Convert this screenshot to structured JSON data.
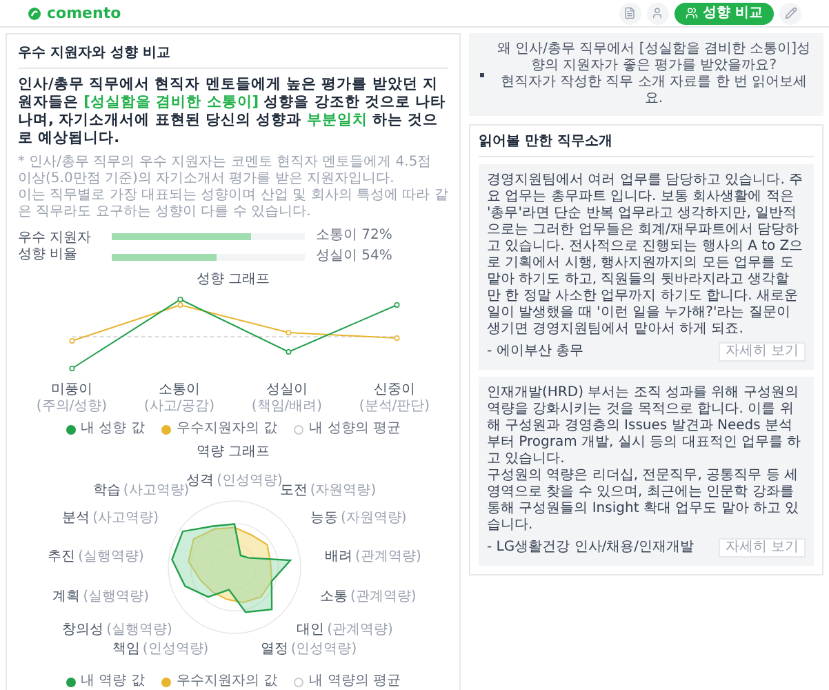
{
  "logo": "comento",
  "side_menu": [
    {
      "kind": "document",
      "selected": false
    },
    {
      "kind": "person",
      "selected": false
    },
    {
      "kind": "compare",
      "selected": true,
      "label": "성향 비교"
    },
    {
      "kind": "pencil",
      "selected": false
    }
  ],
  "comparison": {
    "title": "우수 지원자와 성향 비교",
    "headline": "인사/총무 직무에서 현직자 멘토들에게 높은 평가를 받았던 지원자들은 **[성실함을 겸비한 소통이]** 성향을 강조한 것으로 나타나며, 자기소개서에 표현된 당신의 성향과 **부분일치** 하는 것으로 예상됩니다.",
    "notes": [
      "* 인사/총무 직무의 우수 지원자는 코멘토 현직자 멘토들에게 4.5점 이상(5.0만점 기준)의 자기소개서 평가를 받은 지원자입니다.",
      "이는 직무별로 가장 대표되는 성향이며 산업 및 회사의 특성에 따라 같은 직무라도 요구하는 성향이 다를 수 있습니다."
    ],
    "ratio": {
      "label": "우수 지원자 성향 비율",
      "bars": [
        {
          "label": "소통이 72%",
          "level": 0.72
        },
        {
          "label": "성실이 54%",
          "level": 0.54
        }
      ]
    },
    "trait_chart": {
      "title": "성향 그래프",
      "categories": [
        {
          "name": "미풍이",
          "sub": "(주의/성향)"
        },
        {
          "name": "소통이",
          "sub": "(사고/공감)"
        },
        {
          "name": "성실이",
          "sub": "(책임/배려)"
        },
        {
          "name": "신중이",
          "sub": "(분석/판단)"
        }
      ],
      "legend": [
        {
          "kind": "mine",
          "label": "내 성향 값"
        },
        {
          "kind": "top",
          "label": "우수지원자의 값"
        },
        {
          "kind": "average",
          "label": "내 성향의 평균"
        }
      ]
    },
    "skill_chart": {
      "title": "역량 그래프",
      "axes": [
        {
          "name": "성격",
          "sub": "(인성역량)"
        },
        {
          "name": "학습",
          "sub": "(사고역량)"
        },
        {
          "name": "도전",
          "sub": "(자원역량)"
        },
        {
          "name": "분석",
          "sub": "(사고역량)"
        },
        {
          "name": "능동",
          "sub": "(자원역량)"
        },
        {
          "name": "추진",
          "sub": "(실행역량)"
        },
        {
          "name": "배려",
          "sub": "(관계역량)"
        },
        {
          "name": "계획",
          "sub": "(실행역량)"
        },
        {
          "name": "소통",
          "sub": "(관계역량)"
        },
        {
          "name": "창의성",
          "sub": "(실행역량)"
        },
        {
          "name": "대인",
          "sub": "(관계역량)"
        },
        {
          "name": "책임",
          "sub": "(인성역량)"
        },
        {
          "name": "열정",
          "sub": "(인성역량)"
        }
      ],
      "legend": [
        {
          "kind": "mine",
          "label": "내 역량 값"
        },
        {
          "kind": "top",
          "label": "우수지원자의 값"
        },
        {
          "kind": "average",
          "label": "내 역량의 평균"
        }
      ]
    }
  },
  "banner": {
    "lines": [
      "왜 인사/총무 직무에서 [성실함을 겸비한 소통이]성향의 지원자가 좋은 평가를 받았을까요?",
      "현직자가 작성한 직무 소개 자료를 한 번 읽어보세요."
    ]
  },
  "job_intros": {
    "title": "읽어볼 만한 직무소개",
    "items": [
      {
        "text": "경영지원팀에서 여러 업무를 담당하고 있습니다. 주요 업무는 총무파트 입니다. 보통 회사생활에 적은 '총무'라면 단순 반복 업무라고 생각하지만, 일반적으로는 그러한 업무들은 회계/재무파트에서 담당하고 있습니다. 전사적으로 진행되는 행사의 A to Z으로 기획에서 시행, 행사지원까지의 모든 업무를 도맡아 하기도 하고, 직원들의 뒷바라지라고 생각할 만 한 정말 사소한 업무까지 하기도 합니다. 새로운 일이 발생했을 때 '이런 일을 누가해?'라는 질문이 생기면 경영지원팀에서 맡아서 하게 되죠.",
        "author": "- 에이부산 총무",
        "button": "자세히 보기"
      },
      {
        "text": "인재개발(HRD) 부서는 조직 성과를 위해 구성원의 역량을 강화시키는 것을 목적으로 합니다. 이를 위해 구성원과 경영층의 Issues 발견과 Needs 분석부터 Program 개발, 실시 등의 대표적인 업무를 하고 있습니다.\n구성원의 역량은 리더십, 전문직무, 공통직무 등 세 영역으로 찾을 수 있으며, 최근에는 인문학 강좌를 통해 구성원들의 Insight 확대 업무도 맡아 하고 있습니다.",
        "author": "- LG생활건강 인사/채용/인재개발",
        "button": "자세히 보기"
      }
    ]
  }
}
